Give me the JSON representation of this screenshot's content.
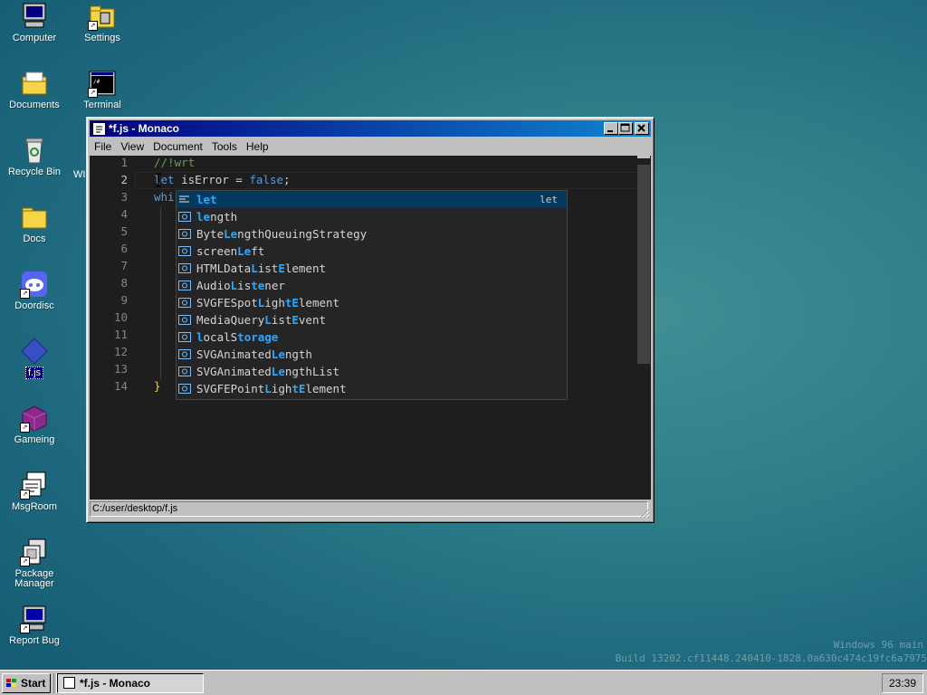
{
  "desktop": {
    "icons": [
      {
        "label": "Computer"
      },
      {
        "label": "Settings"
      },
      {
        "label": "Documents"
      },
      {
        "label": "Terminal"
      },
      {
        "label": "Recycle Bin"
      },
      {
        "label": "Docs"
      },
      {
        "label": "Doordisc"
      },
      {
        "label": "f.js"
      },
      {
        "label": "Gameing"
      },
      {
        "label": "MsgRoom"
      },
      {
        "label": "Package Manager"
      },
      {
        "label": "Report Bug"
      }
    ],
    "hidden_icon_fragment": "WI",
    "watermark": {
      "line1": "Windows 96 main",
      "line2": "Build 13202.cf11448.240410-1828.0a630c474c19fc6a7975"
    }
  },
  "window": {
    "title": "*f.js - Monaco",
    "minimize": "_",
    "maximize": "□",
    "close": "×",
    "menu": [
      "File",
      "View",
      "Document",
      "Tools",
      "Help"
    ],
    "status_path": "C:/user/desktop/f.js"
  },
  "editor": {
    "line_numbers": [
      "1",
      "2",
      "3",
      "4",
      "5",
      "6",
      "7",
      "8",
      "9",
      "10",
      "11",
      "12",
      "13",
      "14"
    ],
    "active_line": 2,
    "code": {
      "line1": "//!wrt",
      "line2_kw": "let",
      "line2_rest": " isError = ",
      "line2_val": "false",
      "line2_end": ";",
      "line3_kw": "whi",
      "line14": "}"
    }
  },
  "suggest": {
    "items": [
      {
        "pre": "",
        "match": "let",
        "post": "",
        "icon": "keyword",
        "detail": "let"
      },
      {
        "pre": "",
        "match": "le",
        "post": "ngth",
        "icon": "variable"
      },
      {
        "pre": "Byte",
        "match": "Le",
        "post": "ngthQueuingStrategy",
        "icon": "variable"
      },
      {
        "pre": "screen",
        "match": "Le",
        "post": "ft",
        "icon": "variable"
      },
      {
        "pre": "HTMLData",
        "match": "L",
        "post": "ist",
        "icon": "variable",
        "match2": "E",
        "post2": "lement"
      },
      {
        "pre": "Audio",
        "match": "L",
        "post": "is",
        "icon": "variable",
        "match2": "te",
        "post2": "ner"
      },
      {
        "pre": "SVGFESpot",
        "match": "L",
        "post": "igh",
        "icon": "variable",
        "match2": "tE",
        "post2": "lement"
      },
      {
        "pre": "MediaQuery",
        "match": "L",
        "post": "ist",
        "icon": "variable",
        "match2": "E",
        "post2": "vent"
      },
      {
        "pre": "",
        "match": "l",
        "post": "ocalS",
        "icon": "variable",
        "match2": "torage",
        "post2": ""
      },
      {
        "pre": "SVGAnimated",
        "match": "Le",
        "post": "ngth",
        "icon": "variable"
      },
      {
        "pre": "SVGAnimated",
        "match": "Le",
        "post": "ngthList",
        "icon": "variable"
      },
      {
        "pre": "SVGFEPoint",
        "match": "L",
        "post": "igh",
        "icon": "variable",
        "match2": "tE",
        "post2": "lement"
      }
    ]
  },
  "taskbar": {
    "start_label": "Start",
    "task_label": "*f.js - Monaco",
    "clock": "23:39"
  }
}
